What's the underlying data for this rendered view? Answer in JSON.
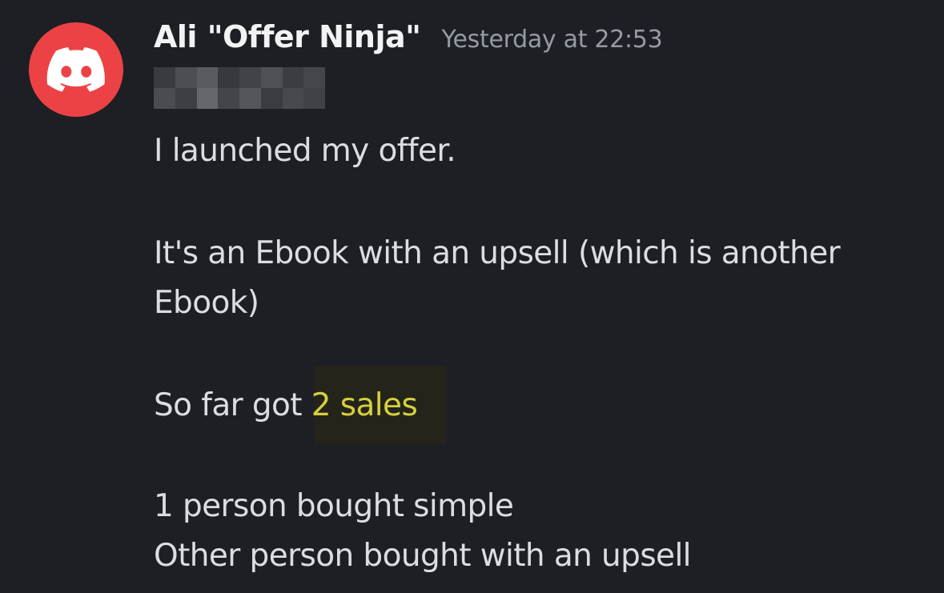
{
  "author": {
    "name": "Ali \"Offer Ninja\"",
    "avatar_icon": "discord-logo-icon",
    "avatar_color": "#ed4245"
  },
  "timestamp": "Yesterday at 22:53",
  "message": {
    "line1": "I launched my offer.",
    "line2": "It's an Ebook with an upsell (which is another",
    "line3": "Ebook)",
    "line4_prefix": "So far got ",
    "line4_highlight": "2 sales",
    "line5": "1 person bought simple",
    "line6": "Other person bought with an upsell"
  },
  "colors": {
    "background": "#1e1f24",
    "text": "#dbdee1",
    "highlight_text": "#d7cf3e",
    "timestamp": "#949ba4"
  }
}
